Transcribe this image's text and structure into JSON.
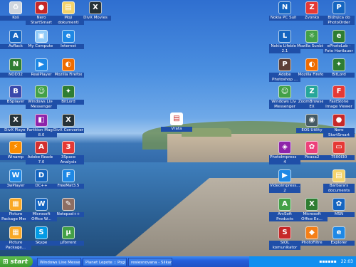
{
  "desktop": {
    "icons": [
      {
        "label": "Koš",
        "icon": "recycle-bin-icon",
        "color": "#cfd6de"
      },
      {
        "label": "Nero StartSmart",
        "icon": "nero-icon",
        "color": "#c62828"
      },
      {
        "label": "Moji dokumenti",
        "icon": "folder-icon",
        "color": "#f3d36b"
      },
      {
        "label": "DivX Movies",
        "icon": "divx-icon",
        "color": "#263238"
      },
      {
        "label": "AvRack",
        "icon": "avrack-icon",
        "color": "#1565c0"
      },
      {
        "label": "My Computer",
        "icon": "computer-icon",
        "color": "#90caf9"
      },
      {
        "label": "Internet",
        "icon": "ie-icon",
        "color": "#1e88e5"
      },
      {
        "label": "NOD32",
        "icon": "nod32-icon",
        "color": "#2e7d32"
      },
      {
        "label": "RealPlayer",
        "icon": "realplayer-icon",
        "color": "#1e88e5"
      },
      {
        "label": "Mozilla Firefox",
        "icon": "firefox-icon",
        "color": "#ef6c00"
      },
      {
        "label": "BSplayer",
        "icon": "bsplayer-icon",
        "color": "#3949ab"
      },
      {
        "label": "Windows Live Messenger",
        "icon": "messenger-icon",
        "color": "#43a047"
      },
      {
        "label": "BitLord",
        "icon": "bitlord-icon",
        "color": "#2e7d32"
      },
      {
        "label": "DivX Player",
        "icon": "divx-player-icon",
        "color": "#263238"
      },
      {
        "label": "Partition Magic 8.0",
        "icon": "partition-icon",
        "color": "#8e24aa"
      },
      {
        "label": "DivX Converter",
        "icon": "divx-converter-icon",
        "color": "#263238"
      },
      {
        "label": "Winamp",
        "icon": "winamp-icon",
        "color": "#fb8c00"
      },
      {
        "label": "Adobe Reader 7.0",
        "icon": "adobe-reader-icon",
        "color": "#d32f2f"
      },
      {
        "label": "3Space Analysis",
        "icon": "3space-icon",
        "color": "#e53935"
      },
      {
        "label": "3wPlayer",
        "icon": "3wplayer-icon",
        "color": "#1e88e5"
      },
      {
        "label": "DC++",
        "icon": "dcpp-icon",
        "color": "#1565c0"
      },
      {
        "label": "FreeMat3.5",
        "icon": "freemat-icon",
        "color": "#1e88e5"
      },
      {
        "label": "Picture Package Menu",
        "icon": "picture-package-icon",
        "color": "#f9a825"
      },
      {
        "label": "Microsoft Office W...",
        "icon": "word-icon",
        "color": "#1565c0"
      },
      {
        "label": "Notepad++",
        "icon": "notepadpp-icon",
        "color": "#8d6e63"
      },
      {
        "label": "Picture Package...",
        "icon": "picture-package-icon",
        "color": "#f9a825"
      },
      {
        "label": "Skype",
        "icon": "skype-icon",
        "color": "#039be5"
      },
      {
        "label": "µTorrent",
        "icon": "utorrent-icon",
        "color": "#43a047"
      },
      {
        "label": "Vrata",
        "icon": "document-icon",
        "color": "#ffffff"
      },
      {
        "label": "Nokia PC Suite",
        "icon": "nokia-icon",
        "color": "#1565c0"
      },
      {
        "label": "Zvonko",
        "icon": "zvonko-icon",
        "color": "#e53935"
      },
      {
        "label": "Bližnjica do PhotoOrder",
        "icon": "photoorder-icon",
        "color": "#1565c0"
      },
      {
        "label": "Nokia Lifeblog 2.1",
        "icon": "lifeblog-icon",
        "color": "#1565c0"
      },
      {
        "label": "Mozilla Sunbird",
        "icon": "sunbird-icon",
        "color": "#43a047"
      },
      {
        "label": "ePhotoLab - Foto Hartlauer",
        "icon": "ephotolab-icon",
        "color": "#2e7d32"
      },
      {
        "label": "Adobe Photoshop ...",
        "icon": "photoshop-icon",
        "color": "#5d4037"
      },
      {
        "label": "Mozilla Firefox",
        "icon": "firefox-icon",
        "color": "#ef6c00"
      },
      {
        "label": "BitLord",
        "icon": "bitlord-icon",
        "color": "#2e7d32"
      },
      {
        "label": "Windows Live Messenger",
        "icon": "messenger-icon",
        "color": "#43a047"
      },
      {
        "label": "ZoomBrowser EX",
        "icon": "zoombrowser-icon",
        "color": "#26a69a"
      },
      {
        "label": "FastStone Image Viewer",
        "icon": "faststone-icon",
        "color": "#e53935"
      },
      {
        "label": "EOS Utility",
        "icon": "eos-icon",
        "color": "#455a64"
      },
      {
        "label": "Nero StartSmart",
        "icon": "nero-icon",
        "color": "#c62828"
      },
      {
        "label": "PhotoImpress... 4",
        "icon": "photoimpression-icon",
        "color": "#8e24aa"
      },
      {
        "label": "Picasa2",
        "icon": "picasa-icon",
        "color": "#ec407a"
      },
      {
        "label": "7500I30",
        "icon": "scanner-icon",
        "color": "#e53935"
      },
      {
        "label": "VideoImpress... 2",
        "icon": "videoimpression-icon",
        "color": "#1e88e5"
      },
      {
        "label": "Barbara's documents",
        "icon": "folder-icon",
        "color": "#f3d36b"
      },
      {
        "label": "ArcSoft Products",
        "icon": "arcsoft-icon",
        "color": "#43a047"
      },
      {
        "label": "Microsoft Office Ex...",
        "icon": "excel-icon",
        "color": "#2e7d32"
      },
      {
        "label": "MSN",
        "icon": "msn-icon",
        "color": "#1565c0"
      },
      {
        "label": "SIOL komunikator",
        "icon": "siol-icon",
        "color": "#c62828"
      },
      {
        "label": "PhotoFiltre",
        "icon": "photofiltre-icon",
        "color": "#f57f17"
      },
      {
        "label": "Explorer",
        "icon": "ie-icon",
        "color": "#1e88e5"
      }
    ]
  },
  "taskbar": {
    "start_label": "start",
    "tasks": [
      "Windows Live Messen...",
      "Planet Lepote :: Pogl...",
      "resiesnovana - Slikar"
    ],
    "clock": "22:03"
  }
}
